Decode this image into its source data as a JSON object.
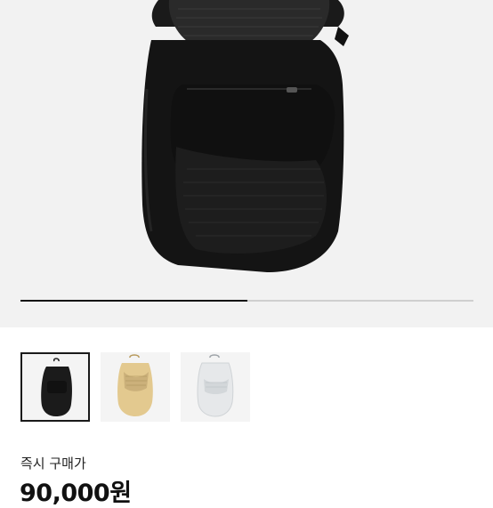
{
  "gallery": {
    "current_slide": 1,
    "total_slides": 3,
    "progress": 0.5
  },
  "thumbnails": [
    {
      "name": "black",
      "color": "#1b1b1b",
      "selected": true
    },
    {
      "name": "beige",
      "color": "#e3c98f",
      "selected": false
    },
    {
      "name": "light-gray",
      "color": "#e6e8ea",
      "selected": false
    }
  ],
  "purchase": {
    "label": "즉시 구매가",
    "price": "90,000원"
  }
}
